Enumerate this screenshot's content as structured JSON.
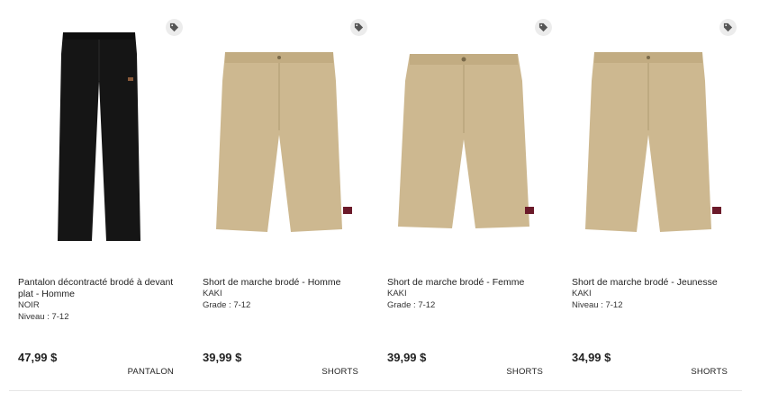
{
  "products": [
    {
      "name": "Pantalon décontracté brodé à devant plat - Homme",
      "color": "NOIR",
      "level": "Niveau : 7-12",
      "price": "47,99 $",
      "category": "PANTALON",
      "garment_color": "#151515",
      "icon": "price-tag-icon"
    },
    {
      "name": "Short de marche brodé - Homme",
      "color": "KAKI",
      "level": "Grade : 7-12",
      "price": "39,99 $",
      "category": "SHORTS",
      "garment_color": "#cdb890",
      "icon": "price-tag-icon"
    },
    {
      "name": "Short de marche brodé - Femme",
      "color": "KAKI",
      "level": "Grade : 7-12",
      "price": "39,99 $",
      "category": "SHORTS",
      "garment_color": "#cdb890",
      "icon": "price-tag-icon"
    },
    {
      "name": "Short de marche brodé - Jeunesse",
      "color": "KAKI",
      "level": "Niveau : 7-12",
      "price": "34,99 $",
      "category": "SHORTS",
      "garment_color": "#cdb890",
      "icon": "price-tag-icon"
    }
  ]
}
